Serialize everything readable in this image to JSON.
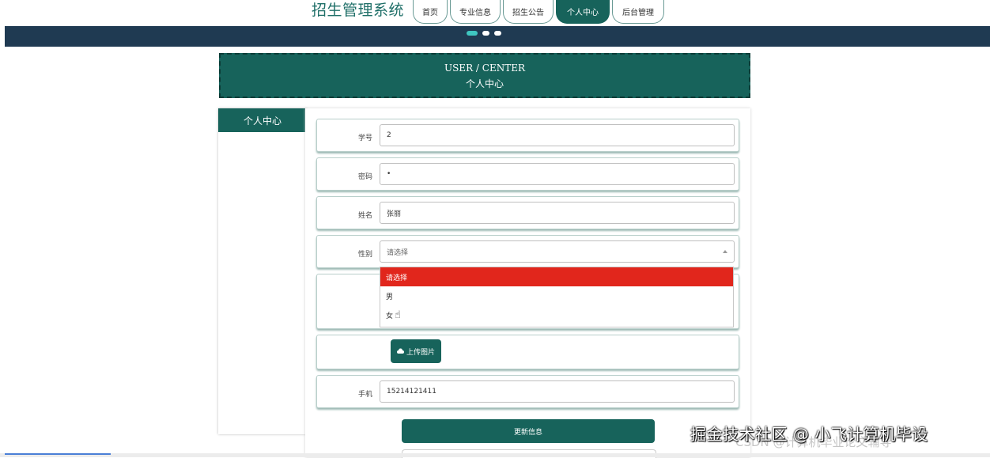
{
  "header": {
    "title": "招生管理系统",
    "tabs": [
      {
        "label": "首页"
      },
      {
        "label": "专业信息"
      },
      {
        "label": "招生公告"
      },
      {
        "label": "个人中心"
      },
      {
        "label": "后台管理"
      }
    ],
    "active_tab_color": "#17635b"
  },
  "banner": {
    "title_en": "USER / CENTER",
    "title_zh": "个人中心"
  },
  "sidebar": {
    "items": [
      {
        "label": "个人中心"
      }
    ]
  },
  "form": {
    "student_id": {
      "label": "学号",
      "value": "2"
    },
    "password": {
      "label": "密码",
      "value": "•"
    },
    "name": {
      "label": "姓名",
      "value": "张丽"
    },
    "gender": {
      "label": "性别",
      "value": "请选择",
      "options": [
        "请选择",
        "男",
        "女"
      ],
      "highlighted": "请选择"
    },
    "upload_label": "上传图片",
    "phone": {
      "label": "手机",
      "value": "15214121411"
    },
    "submit_label": "更新信息"
  },
  "watermark": {
    "primary": "掘金技术社区 @ 小飞计算机毕设",
    "secondary": "CSDN @计算机毕业论文辅导"
  },
  "colors": {
    "primary": "#17635b",
    "header_band": "#1f3a52",
    "highlight": "#e1261c"
  }
}
